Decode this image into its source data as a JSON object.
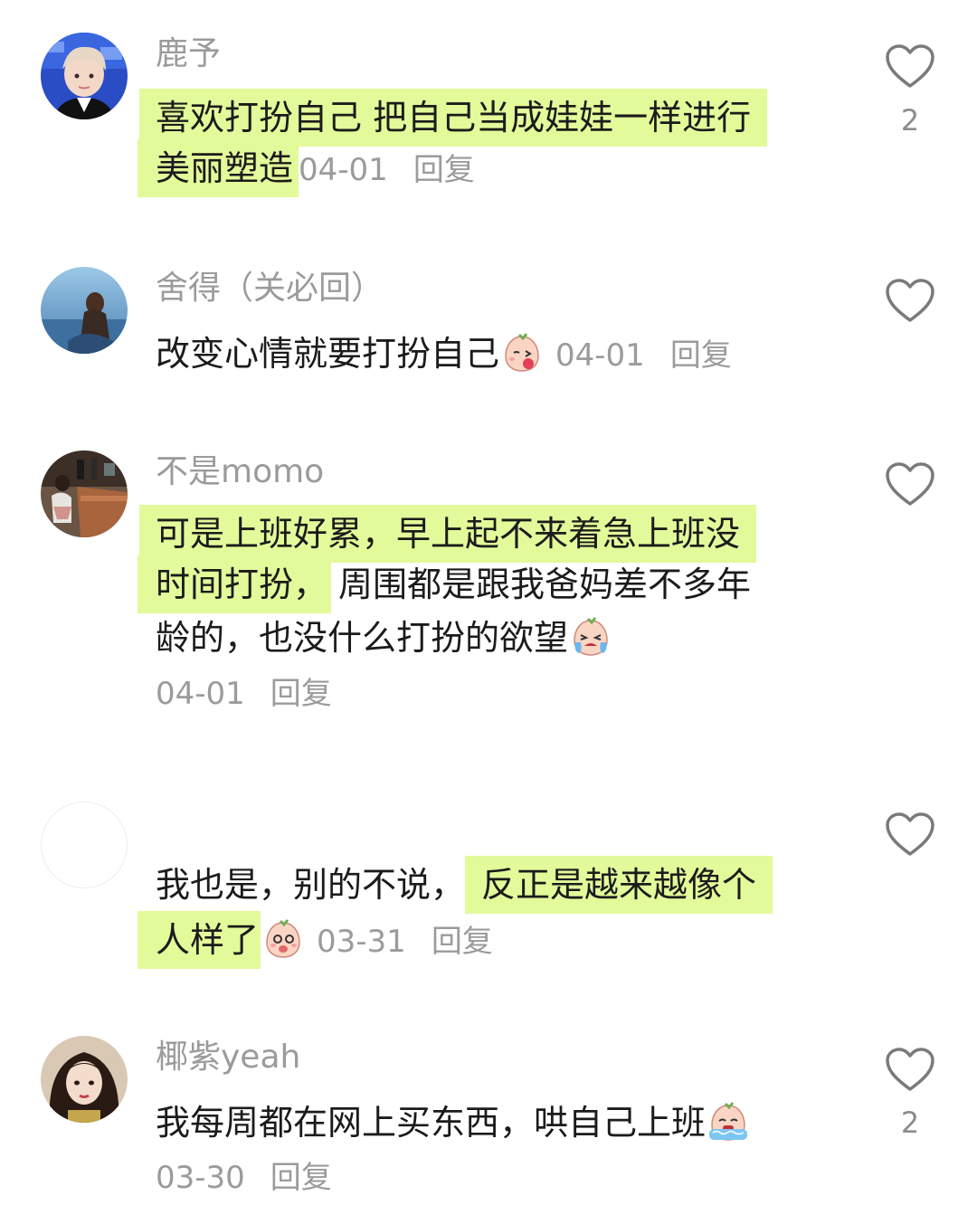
{
  "comments": [
    {
      "username": "鹿予",
      "text_l1": "喜欢打扮自己 把自己当成娃娃一样进行",
      "text_l2": "美丽塑造",
      "date": "04-01",
      "reply": "回复",
      "likes": "2"
    },
    {
      "username": "舍得（关必回）",
      "text_l1": "改变心情就要打扮自己",
      "emoji": "peach-kiss-emoji",
      "date": "04-01",
      "reply": "回复"
    },
    {
      "username": "不是momo",
      "text_l1": "可是上班好累，早上起不来着急上班没",
      "text_l2a": "时间打扮，",
      "text_l2b": "周围都是跟我爸妈差不多年",
      "text_l3": "龄的，也没什么打扮的欲望",
      "emoji": "peach-crying-emoji",
      "date": "04-01",
      "reply": "回复"
    },
    {
      "username": "",
      "text_l1a": "我也是，别的不说，",
      "text_l1b": "反正是越来越像个",
      "text_l2": "人样了",
      "emoji": "peach-shy-emoji",
      "date": "03-31",
      "reply": "回复"
    },
    {
      "username": "椰紫yeah",
      "text_l1": "我每周都在网上买东西，哄自己上班",
      "emoji": "peach-sobbing-emoji",
      "date": "03-30",
      "reply": "回复",
      "likes": "2"
    }
  ],
  "colors": {
    "highlight": "#e3fa9a",
    "username": "#9b9b9b",
    "text": "#1b1b1b",
    "meta": "#9b9b9b"
  }
}
